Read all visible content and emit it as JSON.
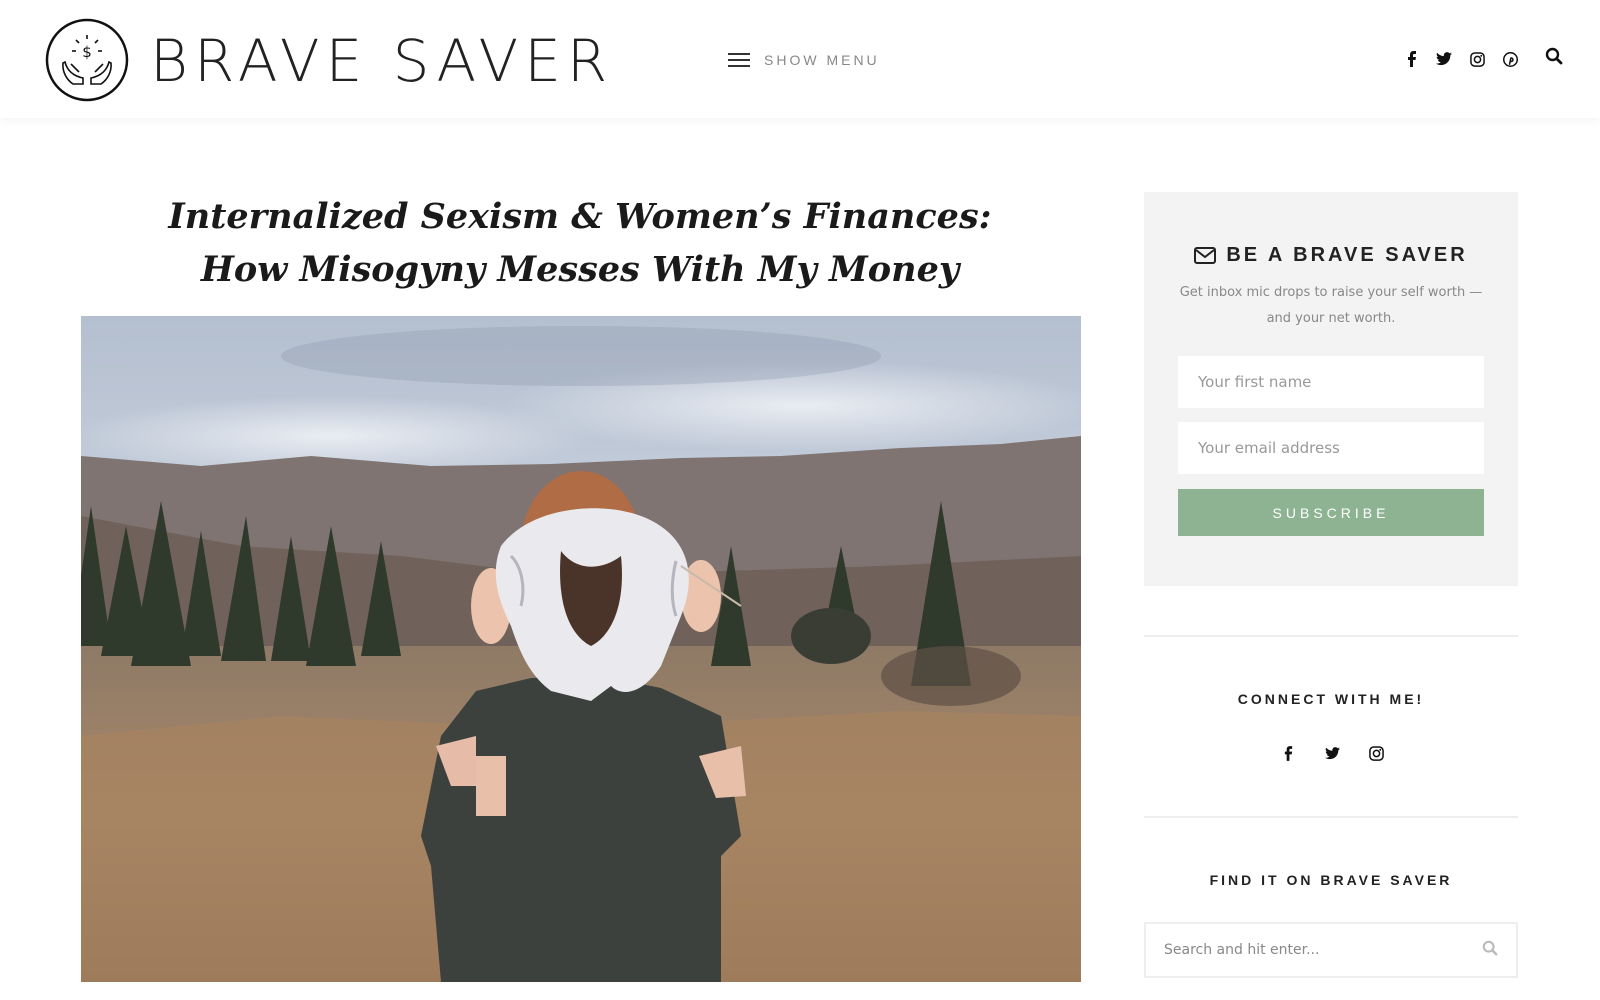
{
  "brand": {
    "name": "BRAVE SAVER",
    "logo_icon": "hands-dollar-icon"
  },
  "header": {
    "menu_label": "SHOW MENU",
    "social": [
      "facebook-icon",
      "twitter-icon",
      "instagram-icon",
      "pinterest-icon"
    ],
    "search_icon": "search-icon"
  },
  "post": {
    "title": "Internalized Sexism & Women’s Finances: How Misogyny Messes With My Money"
  },
  "signup": {
    "title": "BE A BRAVE SAVER",
    "description": "Get inbox mic drops to raise your self worth — and your net worth.",
    "first_name_placeholder": "Your first name",
    "email_placeholder": "Your email address",
    "button_label": "SUBSCRIBE"
  },
  "connect": {
    "title": "CONNECT WITH ME!",
    "social": [
      "facebook-icon",
      "twitter-icon",
      "instagram-icon"
    ]
  },
  "find": {
    "title": "FIND IT ON BRAVE SAVER",
    "search_placeholder": "Search and hit enter..."
  },
  "colors": {
    "accent_green": "#8db392",
    "panel_bg": "#f3f3f3",
    "text_dark": "#222222",
    "text_muted": "#888888"
  }
}
